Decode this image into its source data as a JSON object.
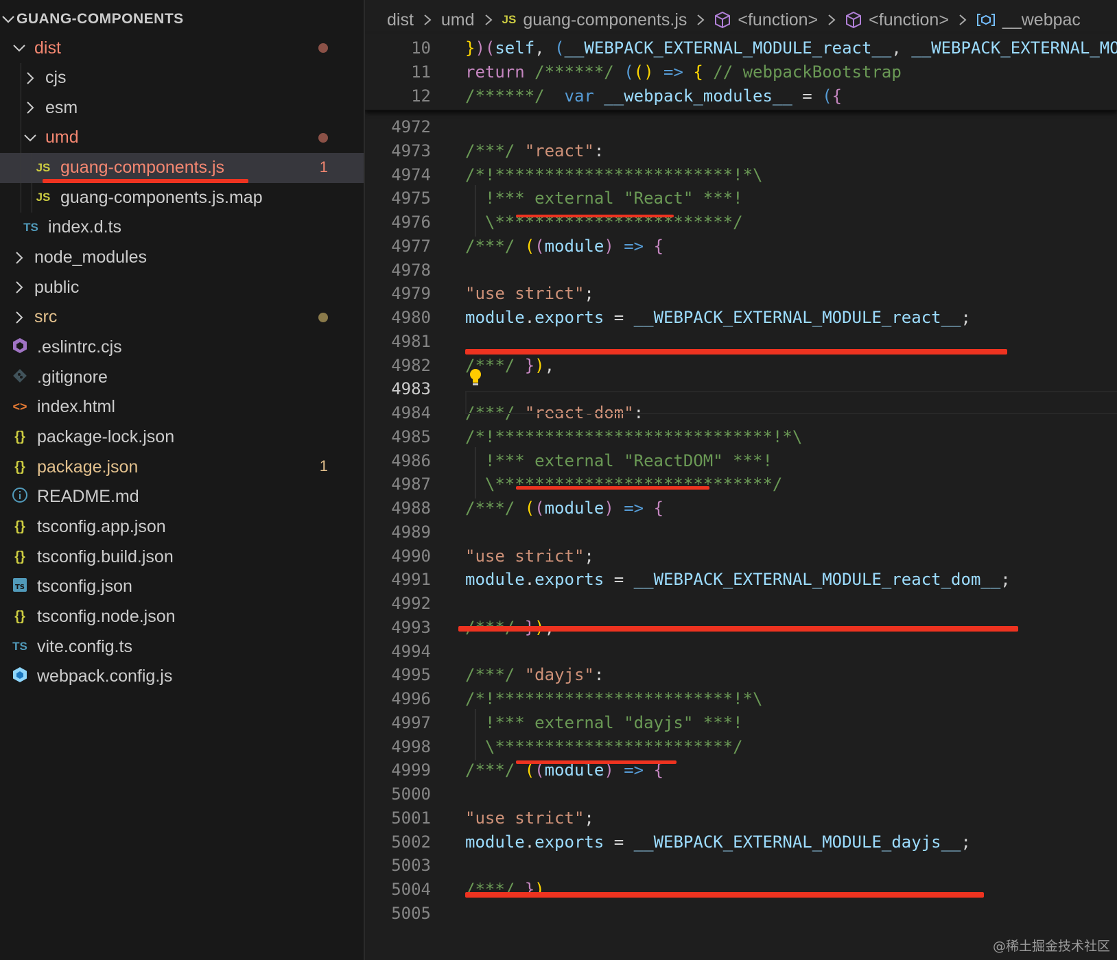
{
  "explorer": {
    "root_label": "GUANG-COMPONENTS",
    "items": [
      {
        "label": "dist",
        "kind": "folder-open",
        "depth": 1,
        "color": "#f48771",
        "status": "dot",
        "dot_color": "#8b5147"
      },
      {
        "label": "cjs",
        "kind": "folder",
        "depth": 2,
        "color": "#cccccc"
      },
      {
        "label": "esm",
        "kind": "folder",
        "depth": 2,
        "color": "#cccccc"
      },
      {
        "label": "umd",
        "kind": "folder-open",
        "depth": 2,
        "color": "#f48771",
        "status": "dot",
        "dot_color": "#8b5147"
      },
      {
        "label": "guang-components.js",
        "kind": "file",
        "icon_text": "JS",
        "icon_color": "#cbcb41",
        "depth": 3,
        "color": "#f48771",
        "selected": true,
        "badge": "1",
        "badge_color": "#f48771"
      },
      {
        "label": "guang-components.js.map",
        "kind": "file",
        "icon_text": "JS",
        "icon_color": "#cbcb41",
        "depth": 3,
        "color": "#cccccc"
      },
      {
        "label": "index.d.ts",
        "kind": "file",
        "icon_text": "TS",
        "icon_color": "#519aba",
        "depth": 2,
        "color": "#cccccc"
      },
      {
        "label": "node_modules",
        "kind": "folder",
        "depth": 1,
        "color": "#cccccc"
      },
      {
        "label": "public",
        "kind": "folder",
        "depth": 1,
        "color": "#cccccc"
      },
      {
        "label": "src",
        "kind": "folder",
        "depth": 1,
        "color": "#e2c08d",
        "status": "dot",
        "dot_color": "#8a7a4a"
      },
      {
        "label": ".eslintrc.cjs",
        "kind": "file",
        "icon_text": "eslint",
        "icon_color": "#a074c4",
        "depth": 1,
        "color": "#cccccc"
      },
      {
        "label": ".gitignore",
        "kind": "file",
        "icon_text": "git",
        "icon_color": "#41535b",
        "depth": 1,
        "color": "#cccccc"
      },
      {
        "label": "index.html",
        "kind": "file",
        "icon_text": "<>",
        "icon_color": "#e37933",
        "depth": 1,
        "color": "#cccccc"
      },
      {
        "label": "package-lock.json",
        "kind": "file",
        "icon_text": "{}",
        "icon_color": "#cbcb41",
        "depth": 1,
        "color": "#cccccc"
      },
      {
        "label": "package.json",
        "kind": "file",
        "icon_text": "{}",
        "icon_color": "#cbcb41",
        "depth": 1,
        "color": "#e2c08d",
        "badge": "1",
        "badge_color": "#e2c08d"
      },
      {
        "label": "README.md",
        "kind": "file",
        "icon_text": "i",
        "icon_color": "#519aba",
        "depth": 1,
        "color": "#cccccc"
      },
      {
        "label": "tsconfig.app.json",
        "kind": "file",
        "icon_text": "{}",
        "icon_color": "#cbcb41",
        "depth": 1,
        "color": "#cccccc"
      },
      {
        "label": "tsconfig.build.json",
        "kind": "file",
        "icon_text": "{}",
        "icon_color": "#cbcb41",
        "depth": 1,
        "color": "#cccccc"
      },
      {
        "label": "tsconfig.json",
        "kind": "file",
        "icon_text": "TS",
        "icon_color": "#519aba",
        "icon_box": true,
        "depth": 1,
        "color": "#cccccc"
      },
      {
        "label": "tsconfig.node.json",
        "kind": "file",
        "icon_text": "{}",
        "icon_color": "#cbcb41",
        "depth": 1,
        "color": "#cccccc"
      },
      {
        "label": "vite.config.ts",
        "kind": "file",
        "icon_text": "TS",
        "icon_color": "#519aba",
        "depth": 1,
        "color": "#cccccc"
      },
      {
        "label": "webpack.config.js",
        "kind": "file",
        "icon_text": "webpack",
        "icon_color": "#8ed6fb",
        "depth": 1,
        "color": "#cccccc"
      }
    ]
  },
  "breadcrumb": [
    {
      "label": "dist",
      "icon": ""
    },
    {
      "label": "umd",
      "icon": ""
    },
    {
      "label": "guang-components.js",
      "icon": "JS"
    },
    {
      "label": "<function>",
      "icon": "cube"
    },
    {
      "label": "<function>",
      "icon": "cube"
    },
    {
      "label": "__webpac",
      "icon": "variable"
    }
  ],
  "sticky_lines": [
    {
      "ln": "10",
      "tokens": [
        [
          "}",
          "tk-y"
        ],
        [
          ")",
          "tk-p"
        ],
        [
          "(",
          "tk-p"
        ],
        [
          "self",
          "tk-v"
        ],
        [
          ", ",
          "tk-w"
        ],
        [
          "(",
          "tk-k"
        ],
        [
          "__WEBPACK_EXTERNAL_MODULE_react__",
          "tk-v"
        ],
        [
          ", ",
          "tk-w"
        ],
        [
          "__WEBPACK_EXTERNAL_MO",
          "tk-v"
        ]
      ]
    },
    {
      "ln": "11",
      "tokens": [
        [
          "return ",
          "tk-p"
        ],
        [
          "/******/ ",
          "tk-c"
        ],
        [
          "(",
          "tk-k"
        ],
        [
          "()",
          "tk-y"
        ],
        [
          " => ",
          "tk-k"
        ],
        [
          "{",
          "tk-y"
        ],
        [
          " // webpackBootstrap",
          "tk-c"
        ]
      ]
    },
    {
      "ln": "12",
      "tokens": [
        [
          "/******/  ",
          "tk-c"
        ],
        [
          "var ",
          "tk-k"
        ],
        [
          "__webpack_modules__",
          "tk-v"
        ],
        [
          " = ",
          "tk-w"
        ],
        [
          "(",
          "tk-k"
        ],
        [
          "{",
          "tk-p"
        ]
      ]
    }
  ],
  "code_lines": [
    {
      "ln": "4972",
      "tokens": []
    },
    {
      "ln": "4973",
      "tokens": [
        [
          "/***/ ",
          "tk-c"
        ],
        [
          "\"react\"",
          "tk-s"
        ],
        [
          ":",
          "tk-w"
        ]
      ]
    },
    {
      "ln": "4974",
      "tokens": [
        [
          "/*!************************!*\\",
          "tk-c"
        ]
      ]
    },
    {
      "ln": "4975",
      "tokens": [
        [
          "  !*** external \"React\" ***!",
          "tk-c"
        ]
      ]
    },
    {
      "ln": "4976",
      "tokens": [
        [
          "  \\************************/",
          "tk-c"
        ]
      ]
    },
    {
      "ln": "4977",
      "tokens": [
        [
          "/***/ ",
          "tk-c"
        ],
        [
          "(",
          "tk-y"
        ],
        [
          "(",
          "tk-p"
        ],
        [
          "module",
          "tk-v"
        ],
        [
          ")",
          "tk-p"
        ],
        [
          " => ",
          "tk-k"
        ],
        [
          "{",
          "tk-p"
        ]
      ]
    },
    {
      "ln": "4978",
      "tokens": []
    },
    {
      "ln": "4979",
      "tokens": [
        [
          "\"use strict\"",
          "tk-s"
        ],
        [
          ";",
          "tk-w"
        ]
      ]
    },
    {
      "ln": "4980",
      "tokens": [
        [
          "module",
          "tk-v"
        ],
        [
          ".",
          "tk-w"
        ],
        [
          "exports",
          "tk-v"
        ],
        [
          " = ",
          "tk-w"
        ],
        [
          "__WEBPACK_EXTERNAL_MODULE_react__",
          "tk-v"
        ],
        [
          ";",
          "tk-w"
        ]
      ]
    },
    {
      "ln": "4981",
      "tokens": []
    },
    {
      "ln": "4982",
      "tokens": [
        [
          "/***/ ",
          "tk-c"
        ],
        [
          "}",
          "tk-p"
        ],
        [
          ")",
          "tk-y"
        ],
        [
          ",",
          "tk-w"
        ]
      ]
    },
    {
      "ln": "4983",
      "tokens": [],
      "active": true
    },
    {
      "ln": "4984",
      "tokens": [
        [
          "/***/ ",
          "tk-c"
        ],
        [
          "\"react-dom\"",
          "tk-s"
        ],
        [
          ":",
          "tk-w"
        ]
      ]
    },
    {
      "ln": "4985",
      "tokens": [
        [
          "/*!****************************!*\\",
          "tk-c"
        ]
      ]
    },
    {
      "ln": "4986",
      "tokens": [
        [
          "  !*** external \"ReactDOM\" ***!",
          "tk-c"
        ]
      ]
    },
    {
      "ln": "4987",
      "tokens": [
        [
          "  \\****************************/",
          "tk-c"
        ]
      ]
    },
    {
      "ln": "4988",
      "tokens": [
        [
          "/***/ ",
          "tk-c"
        ],
        [
          "(",
          "tk-y"
        ],
        [
          "(",
          "tk-p"
        ],
        [
          "module",
          "tk-v"
        ],
        [
          ")",
          "tk-p"
        ],
        [
          " => ",
          "tk-k"
        ],
        [
          "{",
          "tk-p"
        ]
      ]
    },
    {
      "ln": "4989",
      "tokens": []
    },
    {
      "ln": "4990",
      "tokens": [
        [
          "\"use strict\"",
          "tk-s"
        ],
        [
          ";",
          "tk-w"
        ]
      ]
    },
    {
      "ln": "4991",
      "tokens": [
        [
          "module",
          "tk-v"
        ],
        [
          ".",
          "tk-w"
        ],
        [
          "exports",
          "tk-v"
        ],
        [
          " = ",
          "tk-w"
        ],
        [
          "__WEBPACK_EXTERNAL_MODULE_react_dom__",
          "tk-v"
        ],
        [
          ";",
          "tk-w"
        ]
      ]
    },
    {
      "ln": "4992",
      "tokens": []
    },
    {
      "ln": "4993",
      "tokens": [
        [
          "/***/ ",
          "tk-c"
        ],
        [
          "}",
          "tk-p"
        ],
        [
          ")",
          "tk-y"
        ],
        [
          ",",
          "tk-w"
        ]
      ]
    },
    {
      "ln": "4994",
      "tokens": []
    },
    {
      "ln": "4995",
      "tokens": [
        [
          "/***/ ",
          "tk-c"
        ],
        [
          "\"dayjs\"",
          "tk-s"
        ],
        [
          ":",
          "tk-w"
        ]
      ]
    },
    {
      "ln": "4996",
      "tokens": [
        [
          "/*!************************!*\\",
          "tk-c"
        ]
      ]
    },
    {
      "ln": "4997",
      "tokens": [
        [
          "  !*** external \"dayjs\" ***!",
          "tk-c"
        ]
      ]
    },
    {
      "ln": "4998",
      "tokens": [
        [
          "  \\************************/",
          "tk-c"
        ]
      ]
    },
    {
      "ln": "4999",
      "tokens": [
        [
          "/***/ ",
          "tk-c"
        ],
        [
          "(",
          "tk-y"
        ],
        [
          "(",
          "tk-p"
        ],
        [
          "module",
          "tk-v"
        ],
        [
          ")",
          "tk-p"
        ],
        [
          " => ",
          "tk-k"
        ],
        [
          "{",
          "tk-p"
        ]
      ]
    },
    {
      "ln": "5000",
      "tokens": []
    },
    {
      "ln": "5001",
      "tokens": [
        [
          "\"use strict\"",
          "tk-s"
        ],
        [
          ";",
          "tk-w"
        ]
      ]
    },
    {
      "ln": "5002",
      "tokens": [
        [
          "module",
          "tk-v"
        ],
        [
          ".",
          "tk-w"
        ],
        [
          "exports",
          "tk-v"
        ],
        [
          " = ",
          "tk-w"
        ],
        [
          "__WEBPACK_EXTERNAL_MODULE_dayjs__",
          "tk-v"
        ],
        [
          ";",
          "tk-w"
        ]
      ]
    },
    {
      "ln": "5003",
      "tokens": []
    },
    {
      "ln": "5004",
      "tokens": [
        [
          "/***/ ",
          "tk-c"
        ],
        [
          "}",
          "tk-p"
        ],
        [
          ")",
          "tk-y"
        ],
        [
          ",",
          "tk-w"
        ]
      ]
    },
    {
      "ln": "5005",
      "tokens": []
    }
  ],
  "annotation_color": "#ee3320",
  "watermark": "@稀土掘金技术社区"
}
